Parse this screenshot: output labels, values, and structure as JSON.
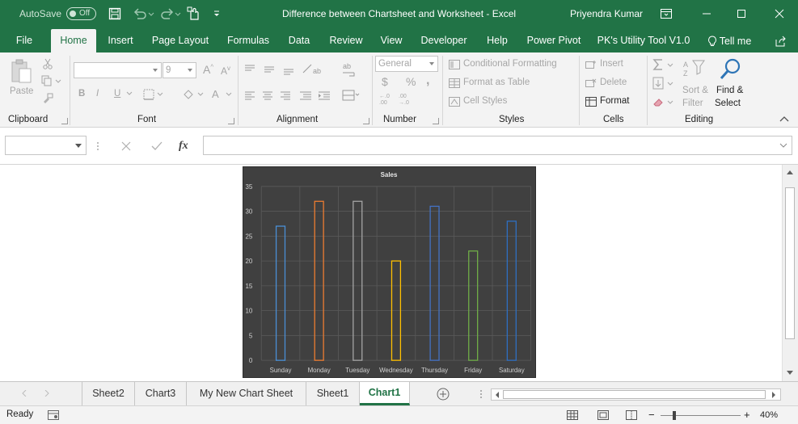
{
  "titlebar": {
    "autosave_label": "AutoSave",
    "autosave_state": "Off",
    "document_title": "Difference between Chartsheet and Worksheet  -  Excel",
    "user_name": "Priyendra Kumar"
  },
  "ribbon_tabs": [
    {
      "label": "File"
    },
    {
      "label": "Home"
    },
    {
      "label": "Insert"
    },
    {
      "label": "Page Layout"
    },
    {
      "label": "Formulas"
    },
    {
      "label": "Data"
    },
    {
      "label": "Review"
    },
    {
      "label": "View"
    },
    {
      "label": "Developer"
    },
    {
      "label": "Help"
    },
    {
      "label": "Power Pivot"
    },
    {
      "label": "PK's Utility Tool V1.0"
    },
    {
      "label": "Tell me"
    }
  ],
  "ribbon": {
    "clipboard": {
      "label": "Clipboard",
      "paste": "Paste"
    },
    "font": {
      "label": "Font",
      "size": "9",
      "bold": "B",
      "italic": "I",
      "underline": "U"
    },
    "alignment": {
      "label": "Alignment"
    },
    "number": {
      "label": "Number",
      "format": "General",
      "currency": "$",
      "percent": "%",
      "comma": ","
    },
    "styles": {
      "label": "Styles",
      "conditional": "Conditional Formatting",
      "format_table": "Format as Table",
      "cell_styles": "Cell Styles"
    },
    "cells": {
      "label": "Cells",
      "insert": "Insert",
      "delete": "Delete",
      "format": "Format"
    },
    "editing": {
      "label": "Editing",
      "sort": "Sort &",
      "filter": "Filter",
      "find": "Find &",
      "select": "Select"
    }
  },
  "formula_bar": {
    "fx": "fx",
    "value": ""
  },
  "sheet_tabs": [
    {
      "label": "Sheet2",
      "active": false
    },
    {
      "label": "Chart3",
      "active": false
    },
    {
      "label": "My New Chart Sheet",
      "active": false
    },
    {
      "label": "Sheet1",
      "active": false
    },
    {
      "label": "Chart1",
      "active": true
    }
  ],
  "status": {
    "ready": "Ready",
    "zoom": "40%"
  },
  "colors": {
    "accent": "#217346",
    "chart_bg": "#404040"
  },
  "chart_data": {
    "type": "bar",
    "title": "Sales",
    "categories": [
      "Sunday",
      "Monday",
      "Tuesday",
      "Wednesday",
      "Thursday",
      "Friday",
      "Saturday"
    ],
    "values": [
      27,
      32,
      32,
      20,
      31,
      22,
      28
    ],
    "bar_colors": [
      "#4a8fd6",
      "#ed7d31",
      "#a5a5a5",
      "#ffc000",
      "#4472c4",
      "#70ad47",
      "#2e6fc2"
    ],
    "ylim": [
      0,
      35
    ],
    "yticks": [
      0,
      5,
      10,
      15,
      20,
      25,
      30,
      35
    ],
    "grid": true,
    "legend": "none"
  }
}
